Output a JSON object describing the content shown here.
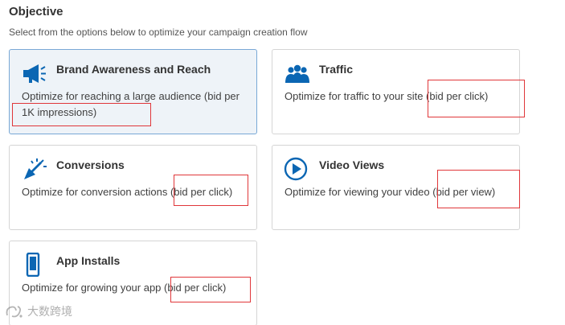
{
  "header": {
    "title": "Objective",
    "subtitle": "Select from the options below to optimize your campaign creation flow"
  },
  "options": [
    {
      "title": "Brand Awareness and Reach",
      "desc": "Optimize for reaching a large audience (bid per 1K impressions)",
      "icon": "megaphone-icon",
      "selected": true
    },
    {
      "title": "Traffic",
      "desc": "Optimize for traffic to your site (bid per click)",
      "icon": "people-icon",
      "selected": false
    },
    {
      "title": "Conversions",
      "desc": "Optimize for conversion actions (bid per click)",
      "icon": "cursor-click-icon",
      "selected": false
    },
    {
      "title": "Video Views",
      "desc": "Optimize for viewing your video (bid per view)",
      "icon": "play-circle-icon",
      "selected": false
    },
    {
      "title": "App Installs",
      "desc": "Optimize for growing your app (bid per click)",
      "icon": "mobile-phone-icon",
      "selected": false
    }
  ],
  "watermark": "大数跨境",
  "colors": {
    "accent": "#0b66b3",
    "selected_bg": "#eef3f8",
    "selected_border": "#79a8d6",
    "highlight_box": "#e0373a"
  }
}
